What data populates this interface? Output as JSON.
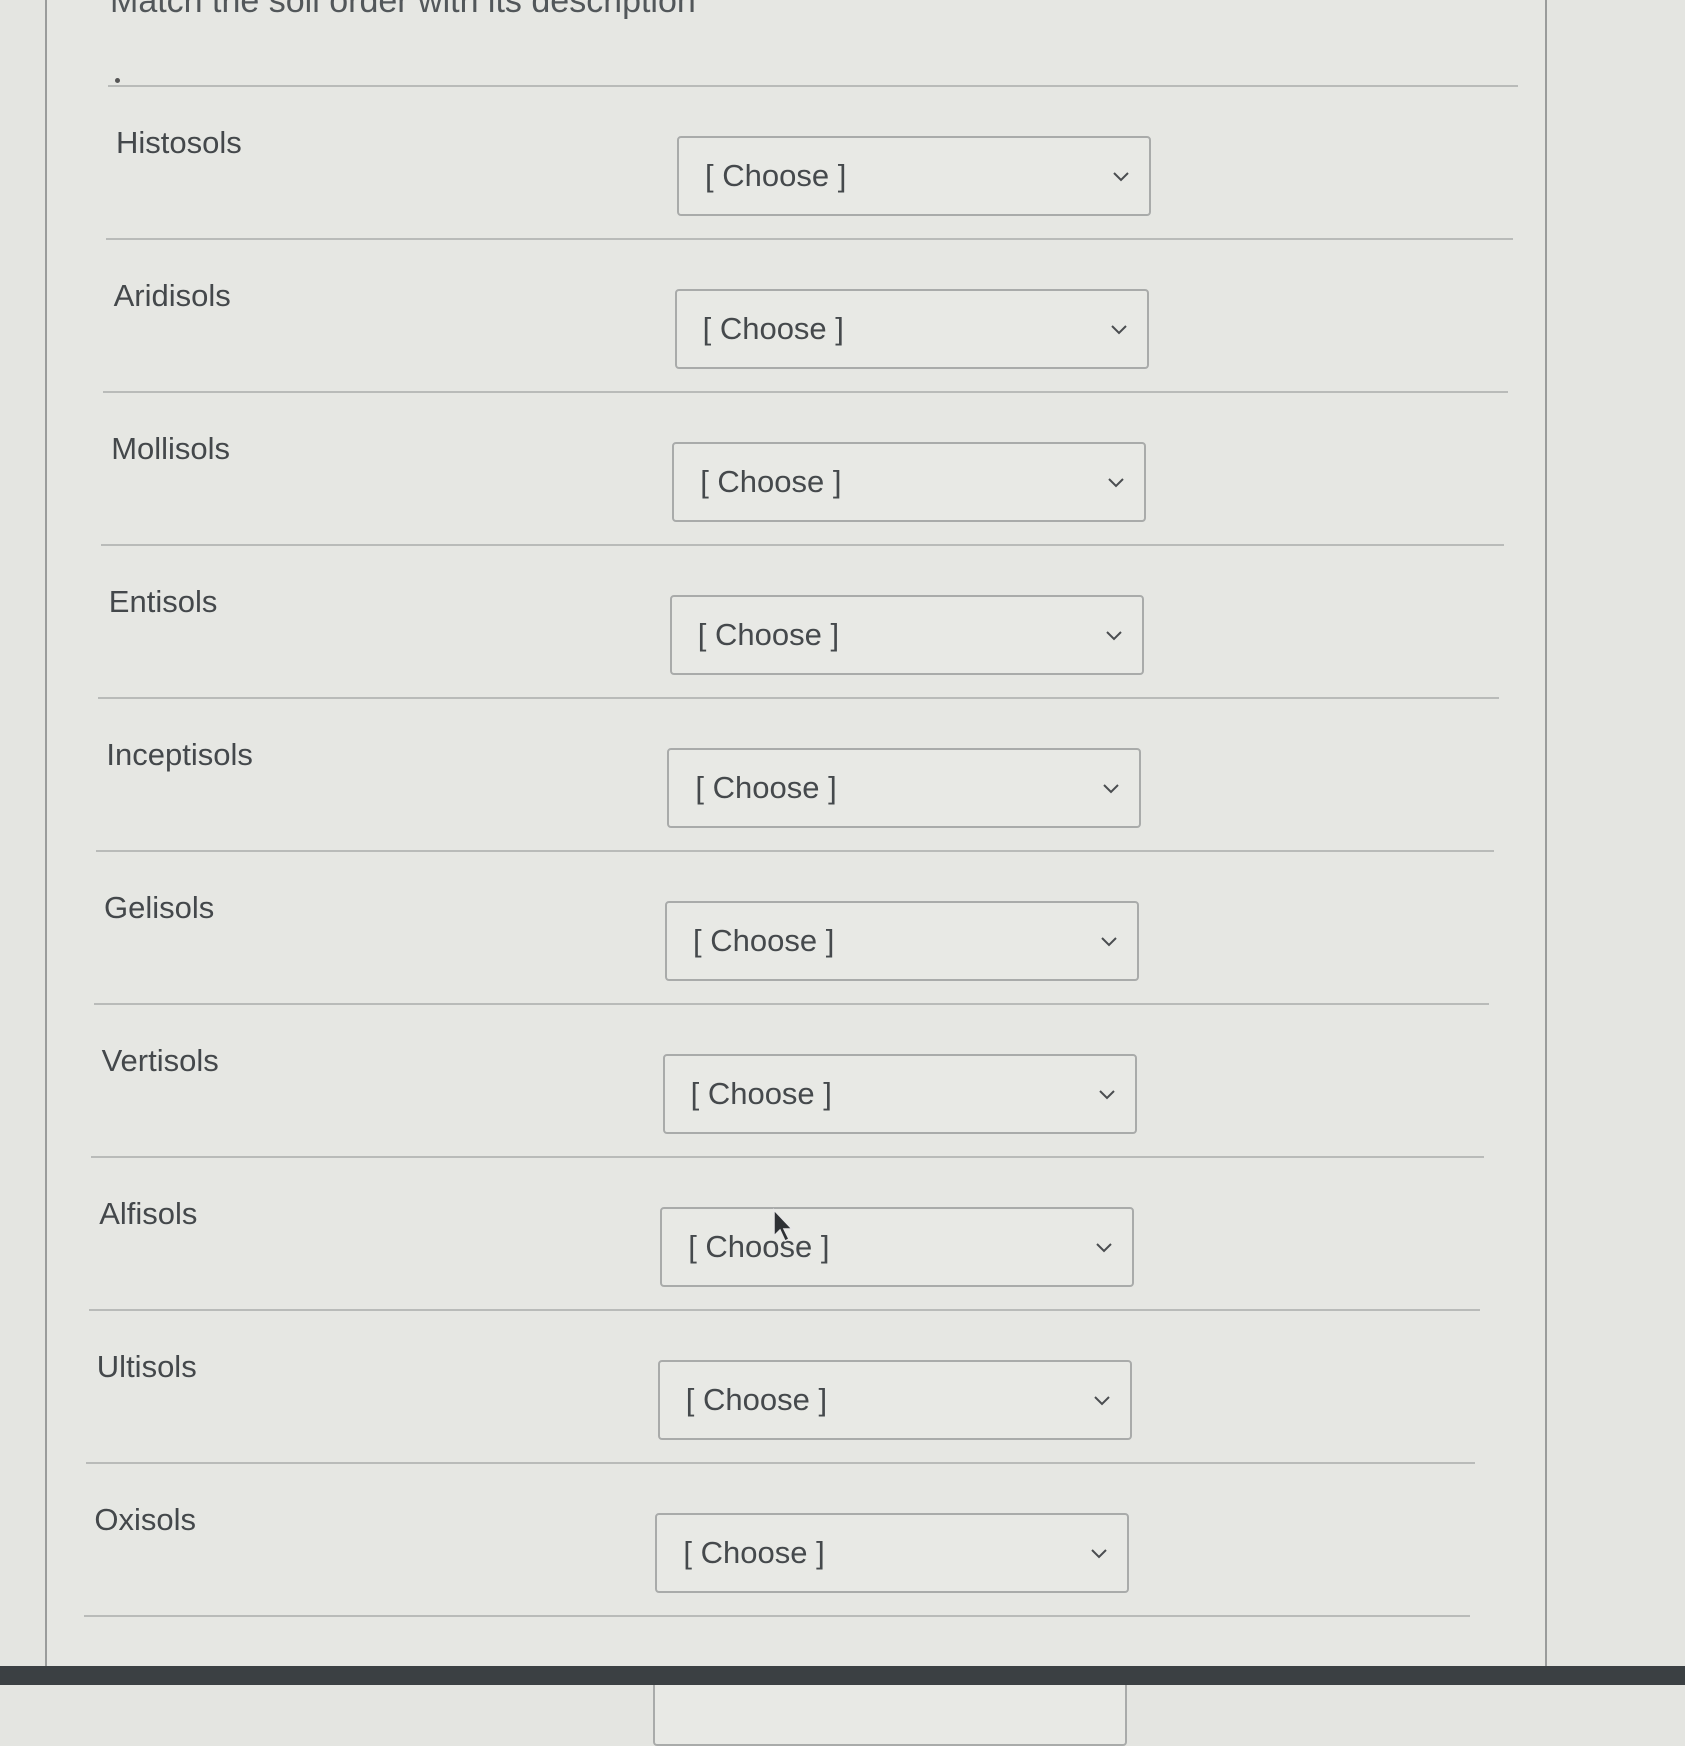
{
  "question": {
    "title": "Match the soil order with its description"
  },
  "rows": [
    {
      "label": "Histosols",
      "selected": "[ Choose ]"
    },
    {
      "label": "Aridisols",
      "selected": "[ Choose ]"
    },
    {
      "label": "Mollisols",
      "selected": "[ Choose ]"
    },
    {
      "label": "Entisols",
      "selected": "[ Choose ]"
    },
    {
      "label": "Inceptisols",
      "selected": "[ Choose ]"
    },
    {
      "label": "Gelisols",
      "selected": "[ Choose ]"
    },
    {
      "label": "Vertisols",
      "selected": "[ Choose ]"
    },
    {
      "label": "Alfisols",
      "selected": "[ Choose ]"
    },
    {
      "label": "Ultisols",
      "selected": "[ Choose ]"
    },
    {
      "label": "Oxisols",
      "selected": "[ Choose ]"
    }
  ],
  "icons": {
    "dropdown": "chevron-down-icon",
    "pointer": "mouse-cursor-icon"
  }
}
